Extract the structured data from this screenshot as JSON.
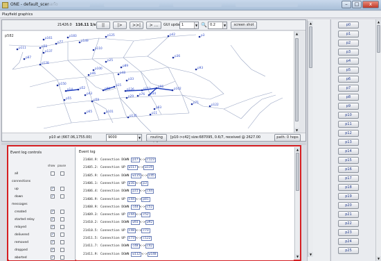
{
  "window": {
    "title": "ONE - default_scenario",
    "buttons": {
      "minimize": "–",
      "maximize": "□",
      "close": "x"
    }
  },
  "menu": {
    "label": "Playfield graphics"
  },
  "toolbar": {
    "sim_time": "21426.0",
    "speed": "116.11 1/s",
    "pause_label": "||",
    "step_label": "|>",
    "ffw_label": ">>|",
    "ffw_to_label": "> ...",
    "gui_update_label": "GUI update:",
    "gui_update_value": "1",
    "zoom_icon": "zoom-icon",
    "zoom_value": "0.2",
    "screenshot_label": "screen shot"
  },
  "map": {
    "corner_label": "p582",
    "nodes": [
      {
        "label": "p183"
      },
      {
        "label": "p125"
      },
      {
        "label": "p42"
      },
      {
        "label": "p3"
      },
      {
        "label": "p161"
      },
      {
        "label": "p77"
      },
      {
        "label": "p58"
      },
      {
        "label": "p149"
      },
      {
        "label": "p111"
      },
      {
        "label": "p137"
      },
      {
        "label": "p110"
      },
      {
        "label": "p87"
      },
      {
        "label": "p25"
      },
      {
        "label": "p36"
      },
      {
        "label": "p89"
      },
      {
        "label": "p128"
      },
      {
        "label": "p100"
      },
      {
        "label": "p93"
      },
      {
        "label": "p46"
      },
      {
        "label": "p48"
      },
      {
        "label": "p33"
      },
      {
        "label": "p150"
      },
      {
        "label": "p14"
      },
      {
        "label": "p52"
      },
      {
        "label": "p99"
      },
      {
        "label": "p15"
      },
      {
        "label": "p126"
      },
      {
        "label": "p112"
      },
      {
        "label": "p96"
      },
      {
        "label": "p102"
      },
      {
        "label": "p34"
      },
      {
        "label": "p55"
      },
      {
        "label": "p43"
      },
      {
        "label": "p59"
      },
      {
        "label": "p29"
      },
      {
        "label": "p76"
      },
      {
        "label": "p71"
      },
      {
        "label": "p122"
      },
      {
        "label": "p65"
      },
      {
        "label": "p101"
      },
      {
        "label": "p83"
      },
      {
        "label": "p11"
      },
      {
        "label": "p135"
      }
    ]
  },
  "status": {
    "coords": "p10 at (667.06,1755.00)",
    "combo_value": "9000",
    "routing_button": "routing info",
    "info": "[p10->c42] size:687095, 0.6/7, received @ 2627.00",
    "path_button": "path: 0 hops"
  },
  "nodes_panel": {
    "items": [
      "p0",
      "p1",
      "p2",
      "p3",
      "p4",
      "p5",
      "p6",
      "p7",
      "p8",
      "p9",
      "p10",
      "p11",
      "p12",
      "p13",
      "p14",
      "p15",
      "p16",
      "p17",
      "p18",
      "p19",
      "p20",
      "p21",
      "p22",
      "p23",
      "p24",
      "p25"
    ]
  },
  "event_controls": {
    "title": "Event log controls",
    "show_label": "show",
    "pause_label": "pause",
    "rows": [
      {
        "label": "all",
        "type": "item",
        "show": false,
        "pause": false
      },
      {
        "label": "connections",
        "type": "header"
      },
      {
        "label": "up",
        "type": "item",
        "show": true,
        "pause": false
      },
      {
        "label": "down",
        "type": "item",
        "show": true,
        "pause": false
      },
      {
        "label": "messages",
        "type": "header"
      },
      {
        "label": "created",
        "type": "item",
        "show": true,
        "pause": false
      },
      {
        "label": "started relay",
        "type": "item",
        "show": true,
        "pause": false
      },
      {
        "label": "relayed",
        "type": "item",
        "show": true,
        "pause": false
      },
      {
        "label": "delivered",
        "type": "item",
        "show": true,
        "pause": false
      },
      {
        "label": "removed",
        "type": "item",
        "show": true,
        "pause": false
      },
      {
        "label": "dropped",
        "type": "item",
        "show": true,
        "pause": false
      },
      {
        "label": "aborted",
        "type": "item",
        "show": true,
        "pause": false
      }
    ]
  },
  "event_log": {
    "title": "Event log",
    "entries": [
      {
        "time": "21404.9",
        "text": "Connection DOWN",
        "a": "p17",
        "b": "c123"
      },
      {
        "time": "21405.2",
        "text": "Connection UP",
        "a": "w117",
        "b": "w119"
      },
      {
        "time": "21405.9",
        "text": "Connection DOWN",
        "a": "w115",
        "b": "c45"
      },
      {
        "time": "21406.1",
        "text": "Connection UP",
        "a": "p16",
        "b": "p3"
      },
      {
        "time": "21406.4",
        "text": "Connection DOWN",
        "a": "p31",
        "b": "c44"
      },
      {
        "time": "21406.9",
        "text": "Connection UP",
        "a": "c44",
        "b": "p81"
      },
      {
        "time": "21408.9",
        "text": "Connection DOWN",
        "a": "c44",
        "b": "c52"
      },
      {
        "time": "21409.3",
        "text": "Connection UP",
        "a": "c44",
        "b": "c52"
      },
      {
        "time": "21410.2",
        "text": "Connection DOWN",
        "a": "w93",
        "b": "w92"
      },
      {
        "time": "21410.5",
        "text": "Connection UP",
        "a": "c48",
        "b": "c73"
      },
      {
        "time": "21411.5",
        "text": "Connection UP",
        "a": "c73",
        "b": "c122"
      },
      {
        "time": "21411.7",
        "text": "Connection DOWN",
        "a": "c48",
        "b": "c42"
      },
      {
        "time": "21411.9",
        "text": "Connection DOWN",
        "a": "w112",
        "b": "w148"
      }
    ]
  }
}
